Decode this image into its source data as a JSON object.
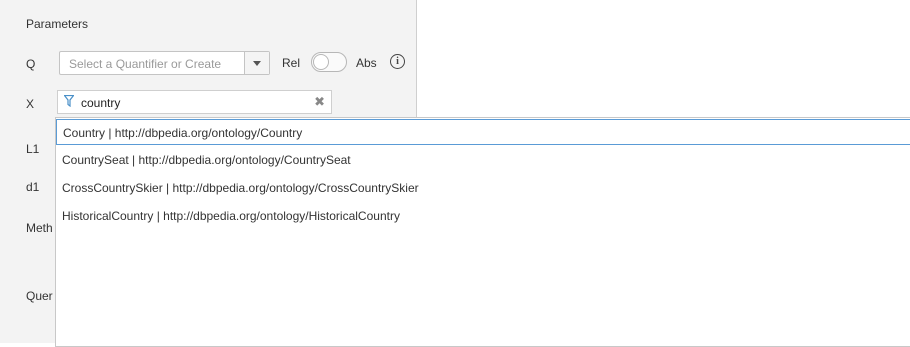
{
  "panel": {
    "title": "Parameters",
    "labels": {
      "q": "Q",
      "x": "X",
      "l1": "L1",
      "d1": "d1",
      "method": "Meth",
      "query": "Quer"
    }
  },
  "quantifier": {
    "placeholder": "Select a Quantifier or Create",
    "rel_label": "Rel",
    "abs_label": "Abs",
    "info_glyph": "i"
  },
  "search": {
    "value": "country",
    "clear_glyph": "✖"
  },
  "dropdown": {
    "selected_index": 0,
    "options": [
      "Country | http://dbpedia.org/ontology/Country",
      "CountrySeat | http://dbpedia.org/ontology/CountrySeat",
      "CrossCountrySkier | http://dbpedia.org/ontology/CrossCountrySkier",
      "HistoricalCountry | http://dbpedia.org/ontology/HistoricalCountry"
    ]
  },
  "colors": {
    "panel_bg": "#f3f3f3",
    "selection_border": "#5a9bd6",
    "filter_icon": "#4a90c8"
  }
}
